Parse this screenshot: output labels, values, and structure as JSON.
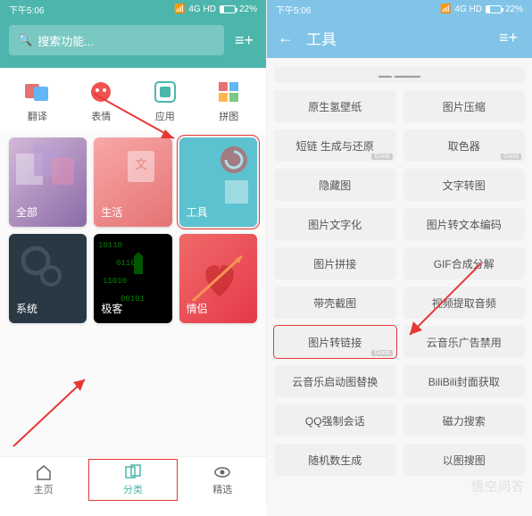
{
  "status": {
    "time": "下午5:06",
    "net": "4G HD",
    "battery": "22%"
  },
  "left": {
    "search_placeholder": "搜索功能...",
    "categories": [
      {
        "label": "翻译"
      },
      {
        "label": "表情"
      },
      {
        "label": "应用"
      },
      {
        "label": "拼图"
      }
    ],
    "cards": [
      {
        "label": "全部"
      },
      {
        "label": "生活"
      },
      {
        "label": "工具"
      },
      {
        "label": "系统"
      },
      {
        "label": "极客"
      },
      {
        "label": "情侣"
      }
    ],
    "nav": [
      {
        "label": "主页"
      },
      {
        "label": "分类"
      },
      {
        "label": "精选"
      }
    ]
  },
  "right": {
    "title": "工具",
    "tools": [
      {
        "label": "原生氢壁纸"
      },
      {
        "label": "图片压缩"
      },
      {
        "label": "短链 生成与还原",
        "badge": "Good"
      },
      {
        "label": "取色器",
        "badge": "Good"
      },
      {
        "label": "隐藏图"
      },
      {
        "label": "文字转图"
      },
      {
        "label": "图片文字化"
      },
      {
        "label": "图片转文本编码"
      },
      {
        "label": "图片拼接"
      },
      {
        "label": "GIF合成分解"
      },
      {
        "label": "带壳截图"
      },
      {
        "label": "视频提取音频"
      },
      {
        "label": "图片转链接",
        "badge": "Good"
      },
      {
        "label": "云音乐广告禁用"
      },
      {
        "label": "云音乐启动图替换"
      },
      {
        "label": "BiliBili封面获取"
      },
      {
        "label": "QQ强制会话"
      },
      {
        "label": "磁力搜索"
      },
      {
        "label": "随机数生成"
      },
      {
        "label": "以图搜图"
      }
    ]
  },
  "watermark": "悟空问答"
}
